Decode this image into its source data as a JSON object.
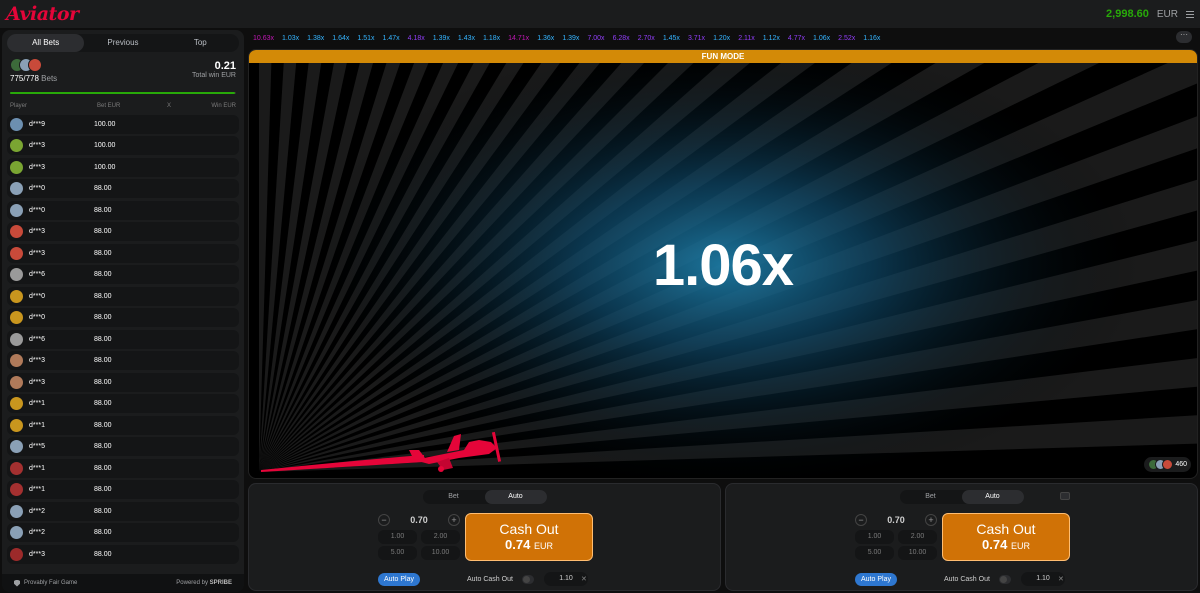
{
  "app": {
    "logo": "Aviator",
    "balance": "2,998.60",
    "currency": "EUR"
  },
  "sidebar": {
    "tabs": [
      "All Bets",
      "Previous",
      "Top"
    ],
    "bets_count": "775/778",
    "bets_label": "Bets",
    "total_win": "0.21",
    "total_win_label": "Total win EUR",
    "progress": 0.996,
    "columns": [
      "Player",
      "Bet EUR",
      "X",
      "Win EUR"
    ],
    "rows": [
      {
        "name": "d***9",
        "bet": "100.00",
        "color": "#6c8fb0"
      },
      {
        "name": "d***3",
        "bet": "100.00",
        "color": "#7aa532"
      },
      {
        "name": "d***3",
        "bet": "100.00",
        "color": "#7aa532"
      },
      {
        "name": "d***0",
        "bet": "88.00",
        "color": "#8aa0b6"
      },
      {
        "name": "d***0",
        "bet": "88.00",
        "color": "#8aa0b6"
      },
      {
        "name": "d***3",
        "bet": "88.00",
        "color": "#c84a3a"
      },
      {
        "name": "d***3",
        "bet": "88.00",
        "color": "#c84a3a"
      },
      {
        "name": "d***6",
        "bet": "88.00",
        "color": "#9a9a9a"
      },
      {
        "name": "d***0",
        "bet": "88.00",
        "color": "#c9961e"
      },
      {
        "name": "d***0",
        "bet": "88.00",
        "color": "#c9961e"
      },
      {
        "name": "d***6",
        "bet": "88.00",
        "color": "#9a9a9a"
      },
      {
        "name": "d***3",
        "bet": "88.00",
        "color": "#b07a5a"
      },
      {
        "name": "d***3",
        "bet": "88.00",
        "color": "#b07a5a"
      },
      {
        "name": "d***1",
        "bet": "88.00",
        "color": "#c9961e"
      },
      {
        "name": "d***1",
        "bet": "88.00",
        "color": "#c9961e"
      },
      {
        "name": "d***5",
        "bet": "88.00",
        "color": "#8aa0b6"
      },
      {
        "name": "d***1",
        "bet": "88.00",
        "color": "#a43030"
      },
      {
        "name": "d***1",
        "bet": "88.00",
        "color": "#a43030"
      },
      {
        "name": "d***2",
        "bet": "88.00",
        "color": "#8aa0b6"
      },
      {
        "name": "d***2",
        "bet": "88.00",
        "color": "#8aa0b6"
      },
      {
        "name": "d***3",
        "bet": "88.00",
        "color": "#9c2a2a"
      }
    ],
    "footer_left": "Provably Fair Game",
    "footer_right_prefix": "Powered by",
    "footer_right_brand": "SPRIBE"
  },
  "history": [
    {
      "v": "10.63x",
      "c": "#c017b4"
    },
    {
      "v": "1.03x",
      "c": "#34b4ff"
    },
    {
      "v": "1.38x",
      "c": "#34b4ff"
    },
    {
      "v": "1.64x",
      "c": "#34b4ff"
    },
    {
      "v": "1.51x",
      "c": "#34b4ff"
    },
    {
      "v": "1.47x",
      "c": "#34b4ff"
    },
    {
      "v": "4.18x",
      "c": "#913ef8"
    },
    {
      "v": "1.39x",
      "c": "#34b4ff"
    },
    {
      "v": "1.43x",
      "c": "#34b4ff"
    },
    {
      "v": "1.18x",
      "c": "#34b4ff"
    },
    {
      "v": "14.71x",
      "c": "#c017b4"
    },
    {
      "v": "1.36x",
      "c": "#34b4ff"
    },
    {
      "v": "1.39x",
      "c": "#34b4ff"
    },
    {
      "v": "7.00x",
      "c": "#913ef8"
    },
    {
      "v": "6.28x",
      "c": "#913ef8"
    },
    {
      "v": "2.70x",
      "c": "#913ef8"
    },
    {
      "v": "1.45x",
      "c": "#34b4ff"
    },
    {
      "v": "3.71x",
      "c": "#913ef8"
    },
    {
      "v": "1.20x",
      "c": "#34b4ff"
    },
    {
      "v": "2.11x",
      "c": "#913ef8"
    },
    {
      "v": "1.12x",
      "c": "#34b4ff"
    },
    {
      "v": "4.77x",
      "c": "#913ef8"
    },
    {
      "v": "1.06x",
      "c": "#34b4ff"
    },
    {
      "v": "2.52x",
      "c": "#913ef8"
    },
    {
      "v": "1.16x",
      "c": "#34b4ff"
    }
  ],
  "history_more": "···",
  "game": {
    "mode": "FUN MODE",
    "multiplier": "1.06x",
    "online": "460"
  },
  "panels": [
    {
      "tabs": [
        "Bet",
        "Auto"
      ],
      "stake": "0.70",
      "quick": [
        "1.00",
        "2.00",
        "5.00",
        "10.00"
      ],
      "cashout_label": "Cash Out",
      "cashout_amount": "0.74",
      "cashout_currency": "EUR",
      "autoplay": "Auto Play",
      "auto_cashout_label": "Auto Cash Out",
      "auto_cashout_value": "1.10"
    },
    {
      "tabs": [
        "Bet",
        "Auto"
      ],
      "stake": "0.70",
      "quick": [
        "1.00",
        "2.00",
        "5.00",
        "10.00"
      ],
      "cashout_label": "Cash Out",
      "cashout_amount": "0.74",
      "cashout_currency": "EUR",
      "autoplay": "Auto Play",
      "auto_cashout_label": "Auto Cash Out",
      "auto_cashout_value": "1.10"
    }
  ]
}
